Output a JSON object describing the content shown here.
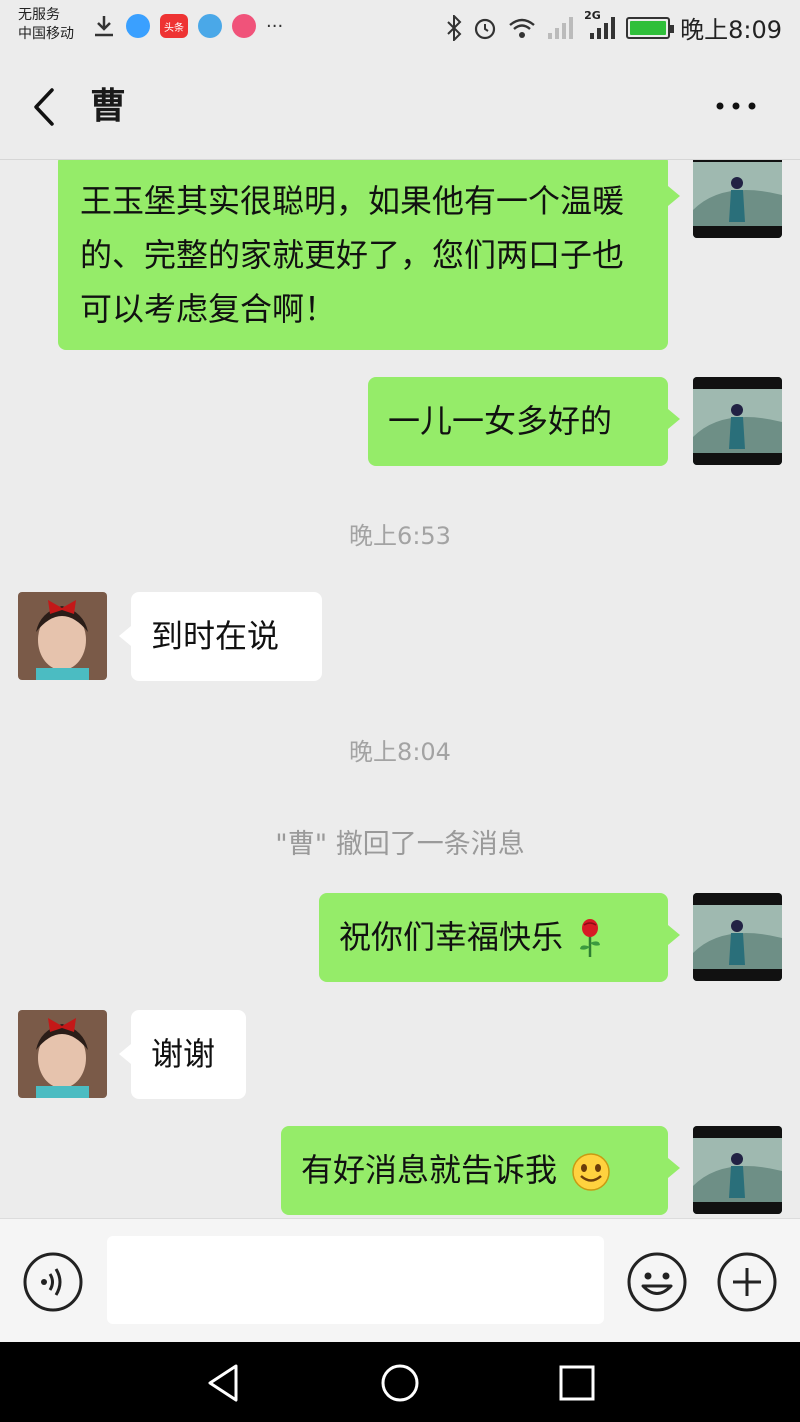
{
  "status_bar": {
    "carrier_line1": "无服务",
    "carrier_line2": "中国移动",
    "app_icon_toutiao": "头条",
    "more_dots": "···",
    "network": "2G",
    "time": "晚上8:09"
  },
  "header": {
    "title": "曹"
  },
  "messages": [
    {
      "side": "out",
      "text": "王玉堡其实很聪明，如果他有一个温暖的、完整的家就更好了，您们两口子也可以考虑复合啊！"
    },
    {
      "side": "out",
      "text": "一儿一女多好的"
    },
    {
      "side": "time",
      "text": "晚上6:53"
    },
    {
      "side": "in",
      "text": "到时在说"
    },
    {
      "side": "time",
      "text": "晚上8:04"
    },
    {
      "side": "system",
      "text": "\"曹\" 撤回了一条消息"
    },
    {
      "side": "out",
      "text": "祝你们幸福快乐",
      "emoji": "rose"
    },
    {
      "side": "in",
      "text": "谢谢"
    },
    {
      "side": "out",
      "text": "有好消息就告诉我",
      "emoji": "smile"
    }
  ],
  "input_bar": {
    "message_value": ""
  },
  "colors": {
    "outgoing_bubble": "#95ec69",
    "incoming_bubble": "#ffffff",
    "background": "#ececec"
  },
  "icons": {
    "back": "chevron-left-icon",
    "more": "more-dots-icon",
    "voice": "voice-icon",
    "emoji": "smiley-icon",
    "plus": "plus-icon",
    "nav_back": "triangle-back-icon",
    "nav_home": "circle-home-icon",
    "nav_recent": "square-recent-icon"
  }
}
